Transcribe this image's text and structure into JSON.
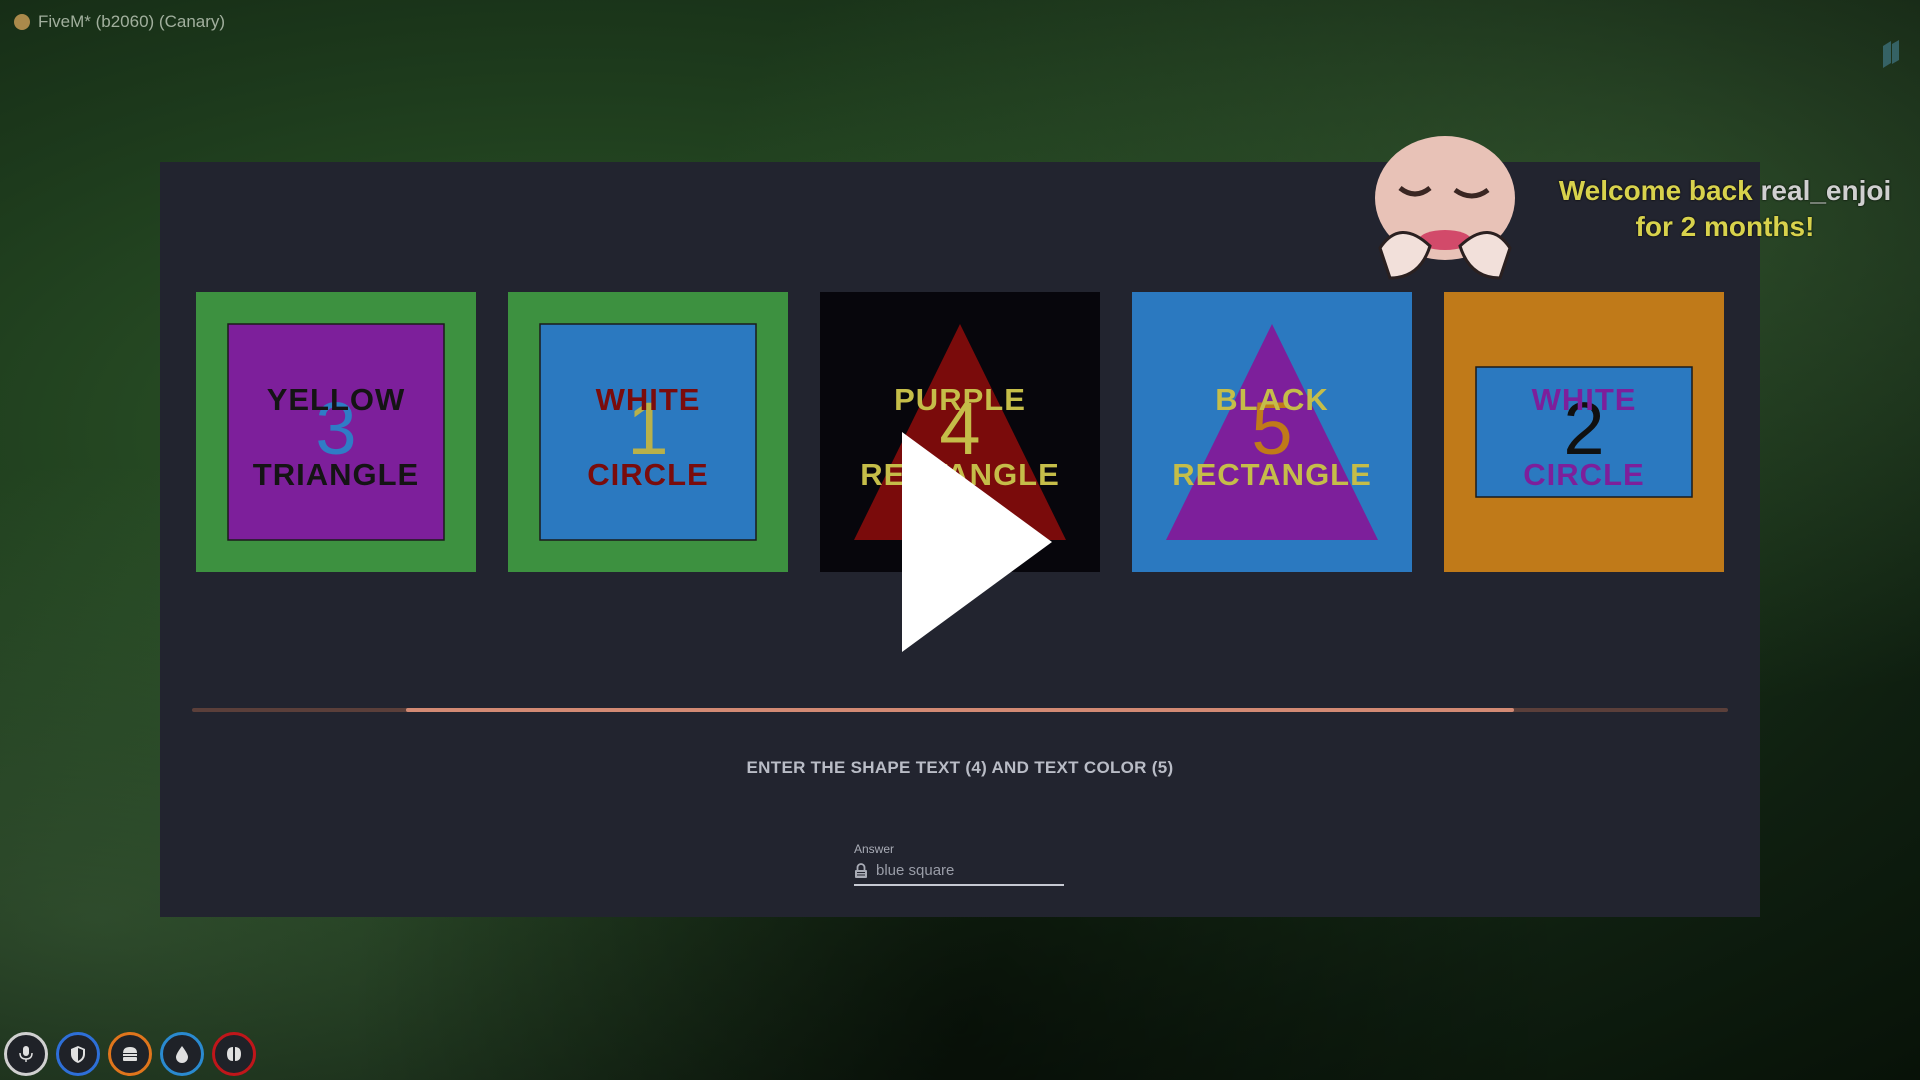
{
  "window": {
    "title": "FiveM* (b2060) (Canary)"
  },
  "tiles": [
    {
      "top_text": "YELLOW",
      "number": "3",
      "bottom_text": "TRIANGLE",
      "shape": "square",
      "bg_color": "#3d9140",
      "shape_color": "#7d1f9b",
      "top_color": "#141414",
      "number_color": "#2f7cc6",
      "bottom_color": "#141414"
    },
    {
      "top_text": "WHITE",
      "number": "1",
      "bottom_text": "CIRCLE",
      "shape": "square",
      "bg_color": "#3d9140",
      "shape_color": "#2b79c0",
      "top_color": "#7a0c0c",
      "number_color": "#b8b14a",
      "bottom_color": "#7a0c0c"
    },
    {
      "top_text": "PURPLE",
      "number": "4",
      "bottom_text": "RECTANGLE",
      "shape": "triangle",
      "bg_color": "#07060c",
      "shape_color": "#7a0b0b",
      "top_color": "#c5bd49",
      "number_color": "#c5bd49",
      "bottom_color": "#c5bd49"
    },
    {
      "top_text": "BLACK",
      "number": "5",
      "bottom_text": "RECTANGLE",
      "shape": "triangle",
      "bg_color": "#2b79c0",
      "shape_color": "#7d1f9b",
      "top_color": "#c5bd49",
      "number_color": "#c07a19",
      "bottom_color": "#c5bd49"
    },
    {
      "top_text": "WHITE",
      "number": "2",
      "bottom_text": "CIRCLE",
      "shape": "rectangle",
      "bg_color": "#c07a19",
      "shape_color": "#2b79c0",
      "top_color": "#7d1f9b",
      "number_color": "#101010",
      "bottom_color": "#7d1f9b"
    }
  ],
  "progress": {
    "fraction_start": 0.139,
    "fraction_end": 0.861,
    "track_color": "#5b3f3a",
    "fill_color": "#d38a74"
  },
  "instruction": "ENTER THE  SHAPE TEXT (4)  AND  TEXT COLOR (5)",
  "answer": {
    "label": "Answer",
    "placeholder": "blue square",
    "value": ""
  },
  "sub_alert": {
    "line1_prefix": "Welcome back ",
    "username": "real_enjoi",
    "line2": "for 2 months!"
  },
  "hud": [
    {
      "name": "microphone-icon",
      "ring_color": "#d0d0d0"
    },
    {
      "name": "shield-icon",
      "ring_color": "#2e6fd8"
    },
    {
      "name": "burger-icon",
      "ring_color": "#e0751c"
    },
    {
      "name": "water-drop-icon",
      "ring_color": "#2a8ad0"
    },
    {
      "name": "brain-icon",
      "ring_color": "#c0161a"
    }
  ],
  "overlay": {
    "play_icon": "play-icon"
  }
}
